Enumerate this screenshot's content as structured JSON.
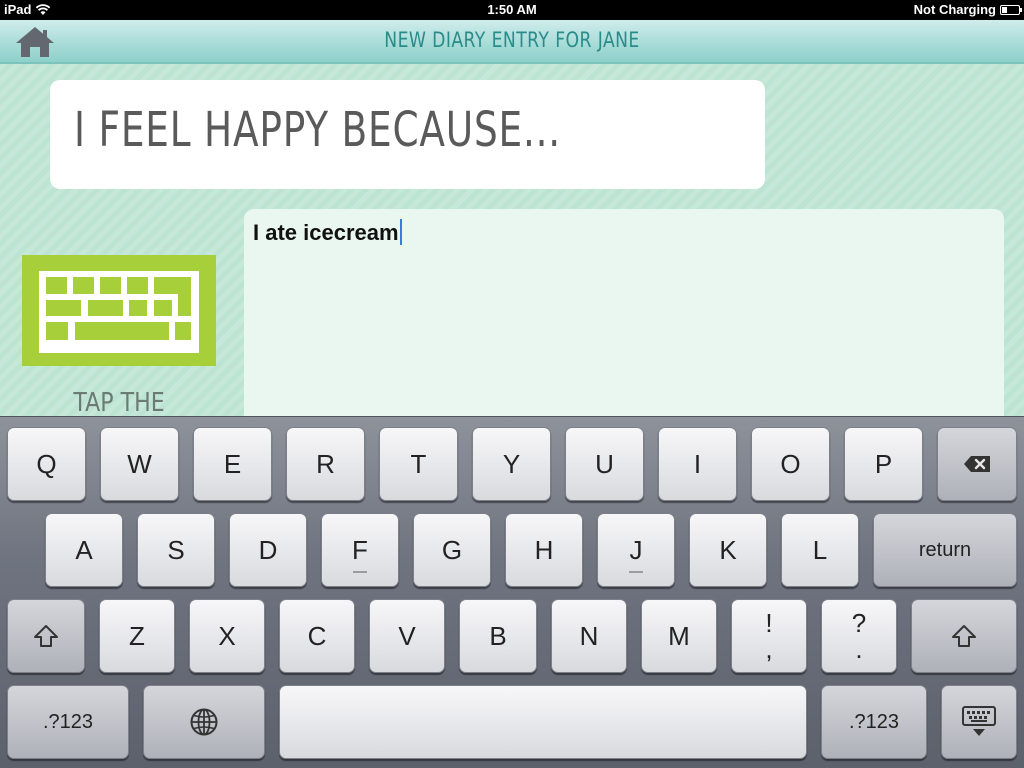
{
  "status_bar": {
    "device": "iPad",
    "time": "1:50 AM",
    "charging": "Not Charging",
    "battery_level": 0.3
  },
  "header": {
    "title": "NEW DIARY ENTRY FOR JANE"
  },
  "prompt": {
    "text": "I FEEL HAPPY BECAUSE..."
  },
  "hint": {
    "text": "TAP THE"
  },
  "entry": {
    "value": "I ate icecream"
  },
  "keyboard": {
    "row1": [
      "Q",
      "W",
      "E",
      "R",
      "T",
      "Y",
      "U",
      "I",
      "O",
      "P"
    ],
    "row2": [
      "A",
      "S",
      "D",
      "F",
      "G",
      "H",
      "J",
      "K",
      "L"
    ],
    "return_label": "return",
    "row3": [
      "Z",
      "X",
      "C",
      "V",
      "B",
      "N",
      "M"
    ],
    "punct1": {
      "top": "!",
      "bottom": ","
    },
    "punct2": {
      "top": "?",
      "bottom": "."
    },
    "numbers_label": ".?123",
    "icons": {
      "backspace": "backspace-icon",
      "shift": "shift-icon",
      "globe": "globe-icon",
      "hide": "hide-keyboard-icon",
      "home": "home-icon"
    }
  }
}
